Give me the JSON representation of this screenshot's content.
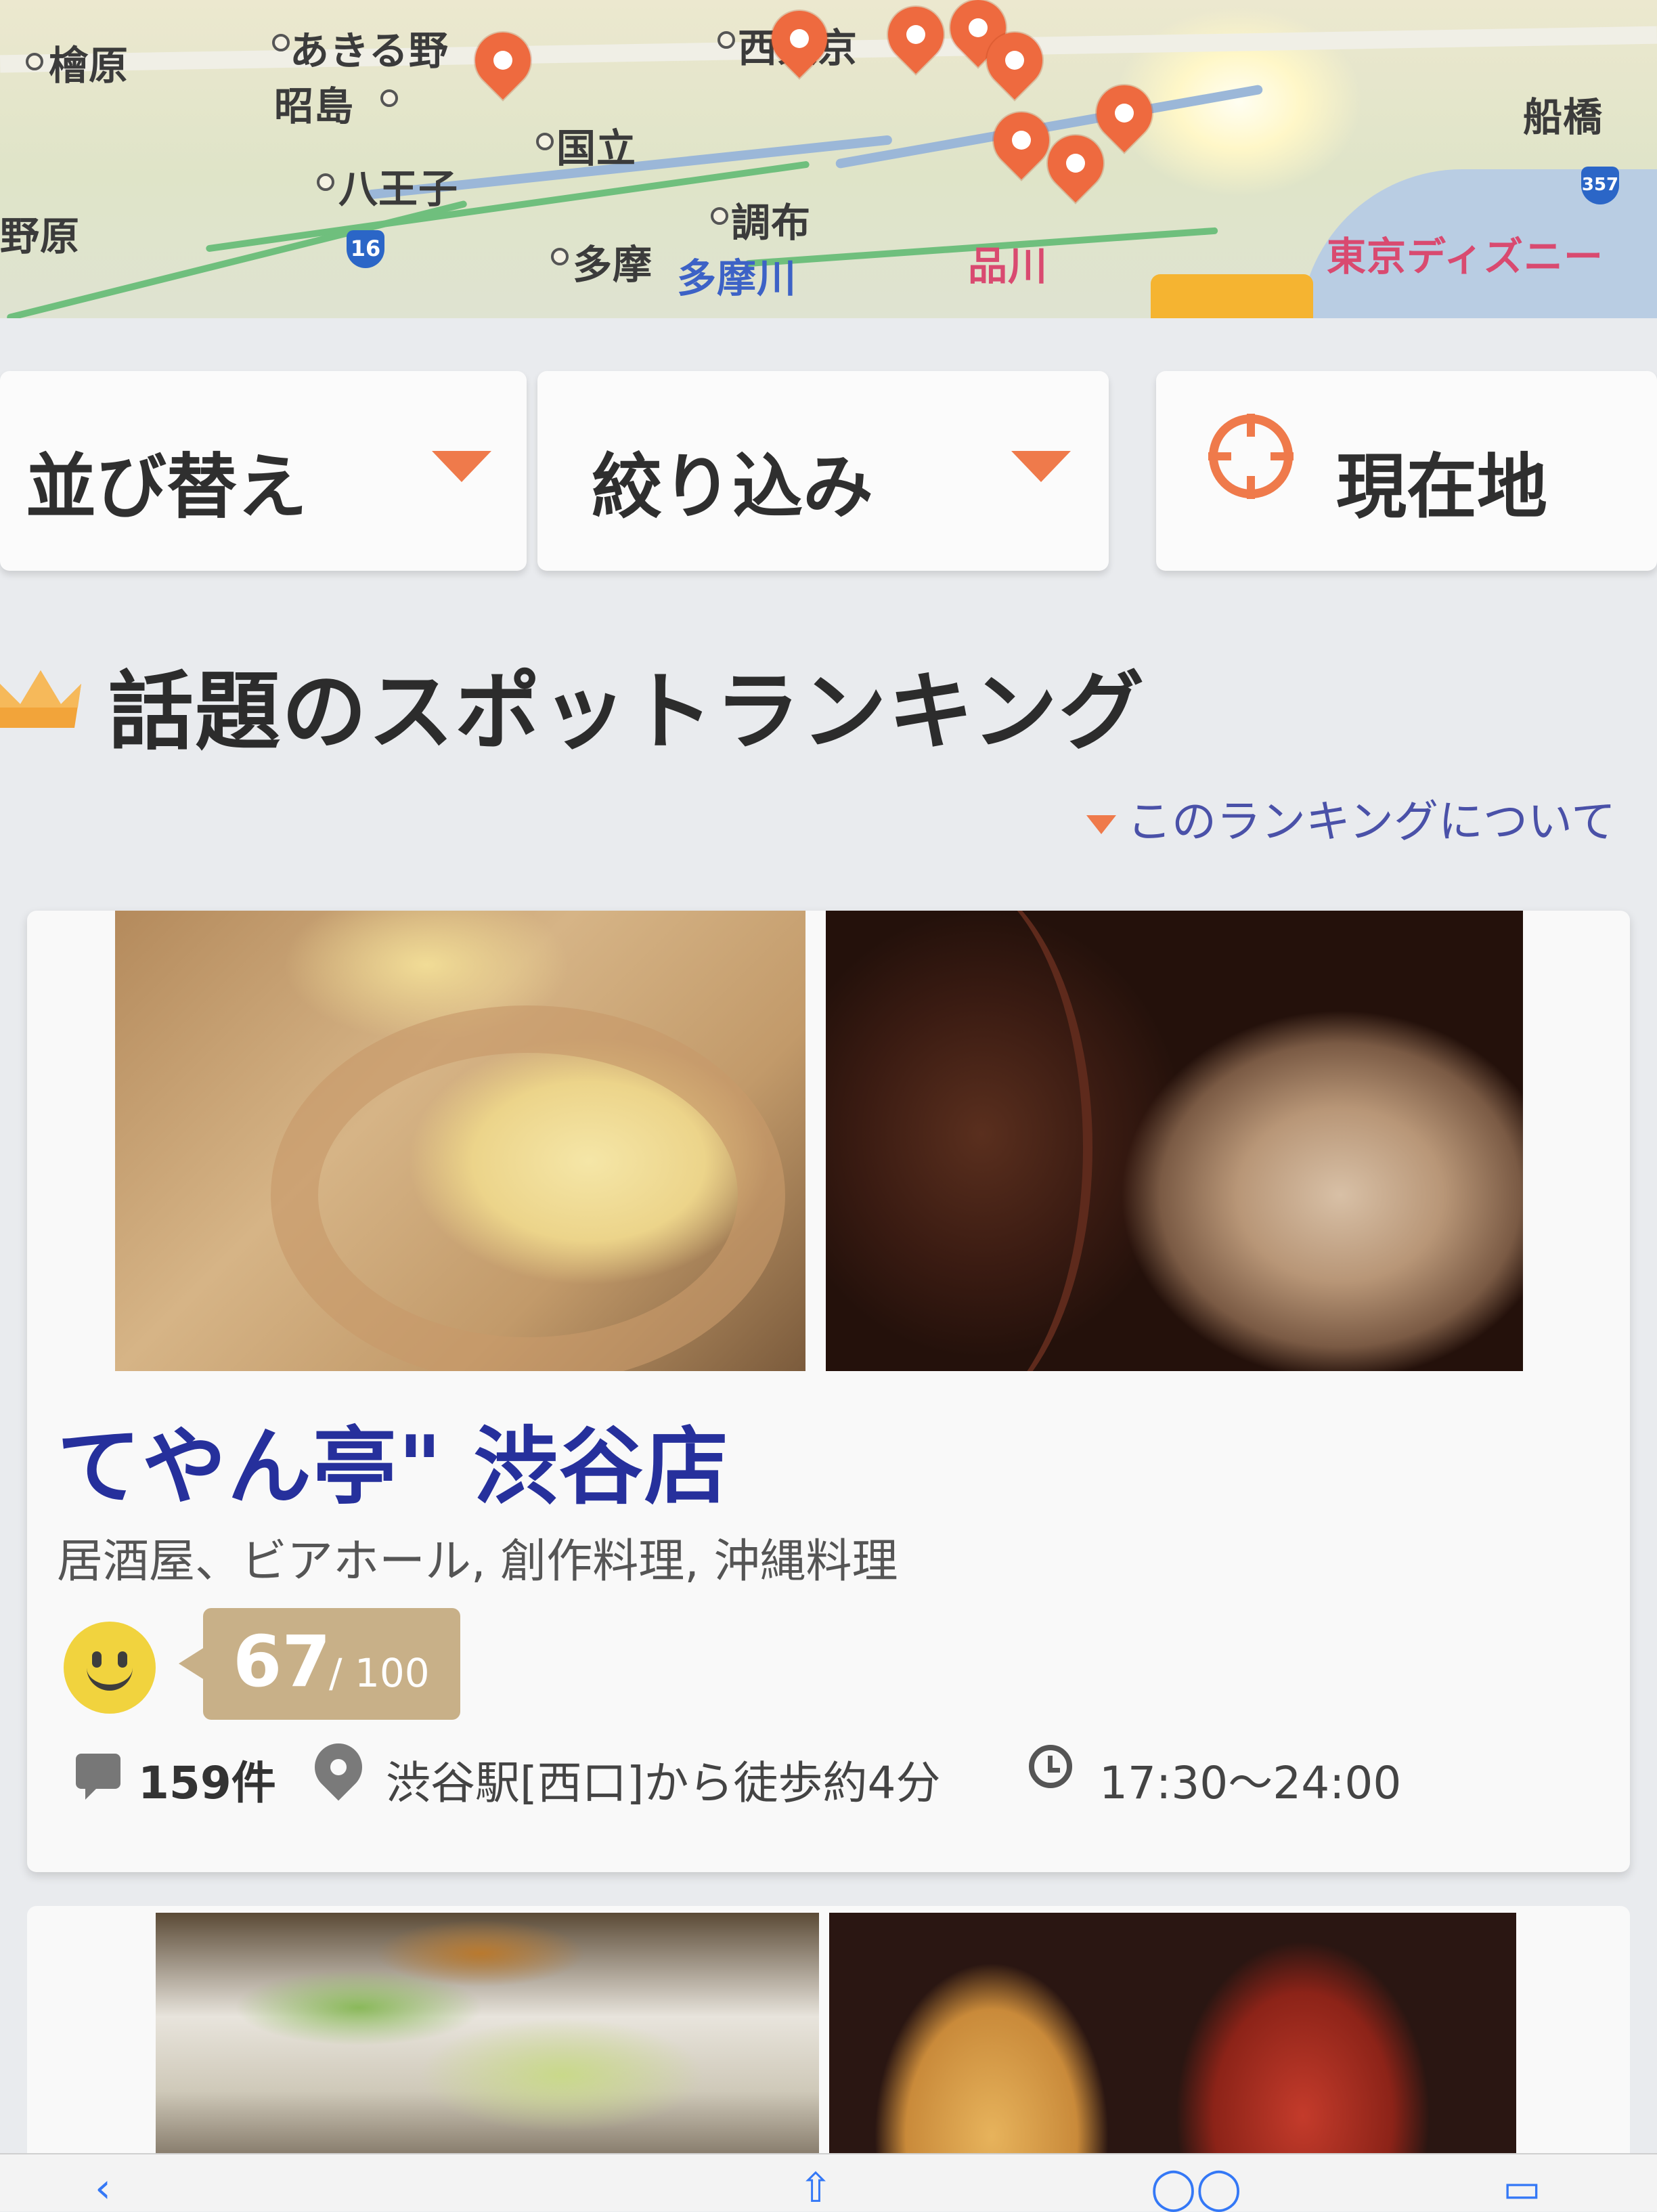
{
  "map": {
    "labels": {
      "hinohara": "檜原",
      "akiruno": "あきる野",
      "akishima": "昭島",
      "kunitachi": "国立",
      "hachioji": "八王子",
      "chofu": "調布",
      "tama": "多摩",
      "tamagawa": "多摩川",
      "shinagawa": "品川",
      "nishitokyo": "西東京",
      "disney": "東京ディズニー",
      "funabashi": "船橋",
      "nohara": "野原",
      "route16": "16",
      "route357": "357"
    }
  },
  "filters": {
    "sort_label": "並び替え",
    "filter_label": "絞り込み",
    "location_label": "現在地"
  },
  "ranking": {
    "title": "話題のスポットランキング",
    "about_link": "このランキングについて"
  },
  "spot": {
    "name": "てやん亭\" 渋谷店",
    "genres": "居酒屋、ビアホール, 創作料理, 沖縄料理",
    "score": "67",
    "score_max": "/ 100",
    "reviews": "159件",
    "access": "渋谷駅[西口]から徒歩約4分",
    "hours": "17:30〜24:00"
  },
  "colors": {
    "accent": "#ef7a4b",
    "title_blue": "#26309c",
    "score_bg": "#c8b088"
  }
}
